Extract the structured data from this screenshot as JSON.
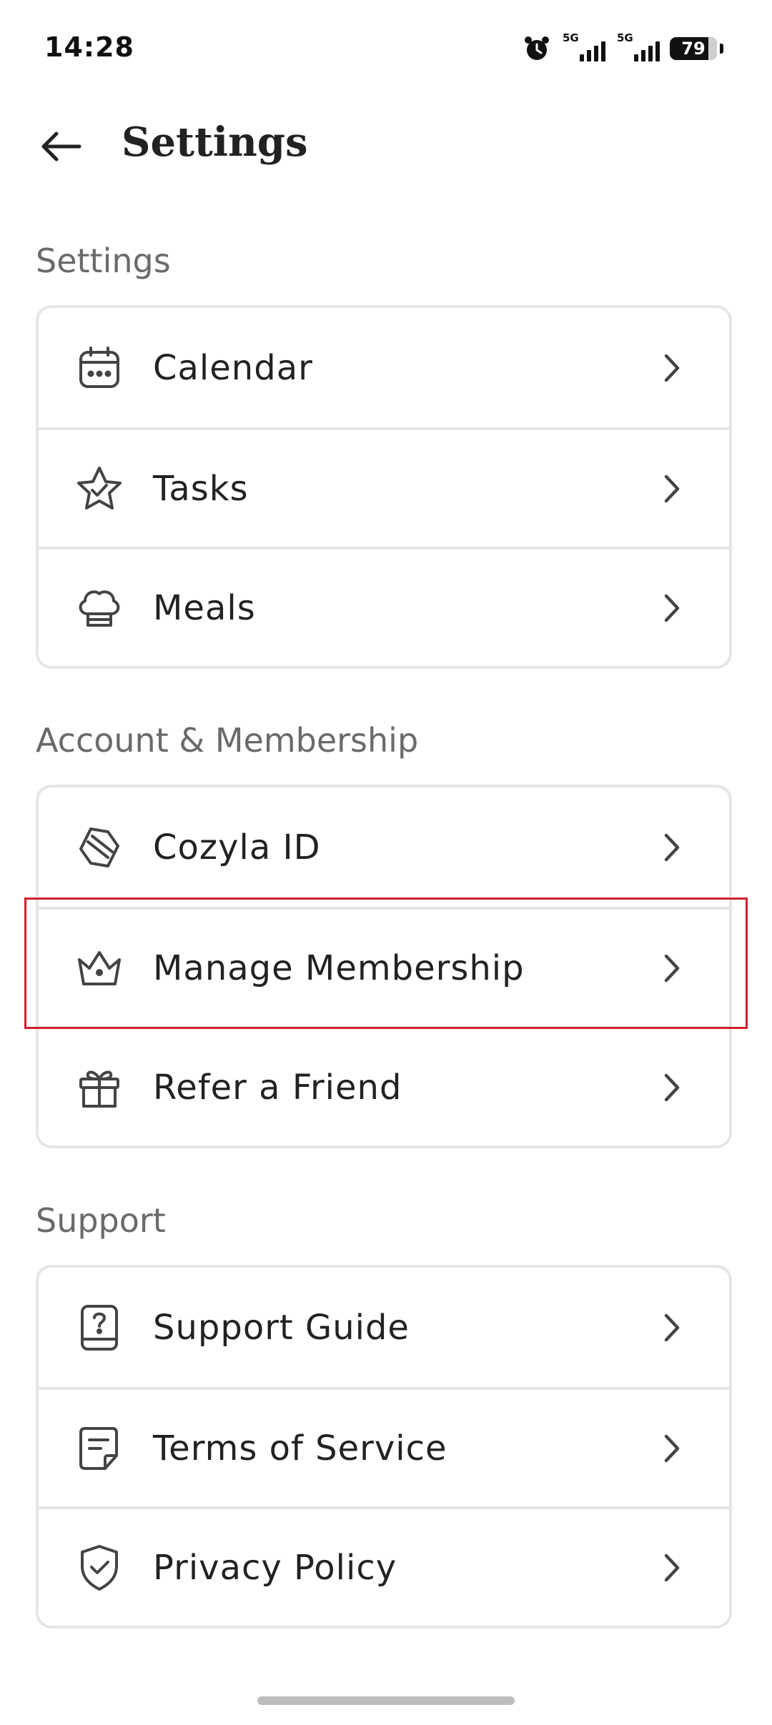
{
  "status": {
    "time": "14:28",
    "network1": "5G",
    "network2": "5G",
    "battery": "79"
  },
  "header": {
    "title": "Settings"
  },
  "sections": [
    {
      "label": "Settings",
      "items": [
        {
          "label": "Calendar"
        },
        {
          "label": "Tasks"
        },
        {
          "label": "Meals"
        }
      ]
    },
    {
      "label": "Account & Membership",
      "items": [
        {
          "label": "Cozyla ID"
        },
        {
          "label": "Manage Membership"
        },
        {
          "label": "Refer a Friend"
        }
      ]
    },
    {
      "label": "Support",
      "items": [
        {
          "label": "Support Guide"
        },
        {
          "label": "Terms of Service"
        },
        {
          "label": "Privacy Policy"
        }
      ]
    }
  ],
  "icons": {
    "calendar": "calendar-icon",
    "tasks": "star-check-icon",
    "meals": "chef-hat-icon",
    "cozyla_id": "id-badge-icon",
    "membership": "crown-icon",
    "refer": "gift-icon",
    "support": "help-book-icon",
    "terms": "document-icon",
    "privacy": "shield-check-icon"
  },
  "colors": {
    "highlight": "#d0202a",
    "divider": "#e6e6e6",
    "section_label": "#6a6a6a"
  }
}
